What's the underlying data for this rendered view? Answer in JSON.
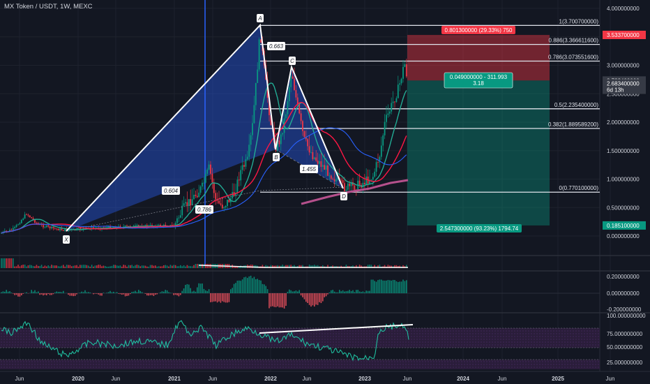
{
  "header": {
    "title": "MX Token / USDT, 1W, MEXC"
  },
  "price_axis": {
    "labels": [
      {
        "v": 4.0,
        "t": "4.000000000"
      },
      {
        "v": 3.5,
        "t": "3.500000000"
      },
      {
        "v": 3.0,
        "t": "3.000000000"
      },
      {
        "v": 2.5,
        "t": "2.500000000"
      },
      {
        "v": 2.0,
        "t": "2.000000000"
      },
      {
        "v": 1.5,
        "t": "1.500000000"
      },
      {
        "v": 1.0,
        "t": "1.000000000"
      },
      {
        "v": 0.5,
        "t": "0.500000000"
      },
      {
        "v": 0.0,
        "t": "0.000000000"
      }
    ],
    "tags": [
      {
        "v": 3.5337,
        "t": "3.533700000",
        "color": "#f23645"
      },
      {
        "v": 2.7324,
        "t": "2.732400000",
        "color": "#363a45"
      },
      {
        "v": 2.6834,
        "t": "2.683400000",
        "color": "#363a45"
      },
      {
        "v": 2.57,
        "t": "6d 13h",
        "color": "#363a45"
      },
      {
        "v": 0.1851,
        "t": "0.185100000",
        "color": "#089981"
      }
    ]
  },
  "macd_axis": [
    "0.200000000",
    "0.000000000",
    "-0.200000000"
  ],
  "rsi_axis": [
    "100.000000000",
    "75.000000000",
    "50.000000000",
    "25.000000000"
  ],
  "time_axis": [
    "Jun",
    "2020",
    "Jun",
    "2021",
    "Jun",
    "2022",
    "Jun",
    "2023",
    "Jun",
    "2024",
    "Jun",
    "2025",
    "Jun"
  ],
  "pattern": {
    "points": [
      "X",
      "A",
      "B",
      "C",
      "D"
    ],
    "ratios": [
      "0.604",
      "0.786",
      "0.663",
      "1.455"
    ]
  },
  "fib_levels": [
    {
      "v": 3.7007,
      "t": "1(3.700700000)"
    },
    {
      "v": 3.3666116,
      "t": "0.886(3.366611600)"
    },
    {
      "v": 3.0735516,
      "t": "0.786(3.073551600)"
    },
    {
      "v": 2.2354,
      "t": "0.5(2.235400000)"
    },
    {
      "v": 1.8895892,
      "t": "0.382(1.889589200)"
    },
    {
      "v": 0.7701,
      "t": "0(0.770100000)"
    }
  ],
  "position": {
    "loss_label": "0.801300000 (29.33%) 750",
    "ratio_label_1": "0.049000000 - 311.993",
    "ratio_label_2": "3.18",
    "profit_label": "2.547300000 (93.23%) 1794.74"
  },
  "colors": {
    "background": "#131722",
    "up": "#089981",
    "down": "#f23645",
    "pattern_fill": "#2962ff",
    "ma_green": "#22ab94",
    "ma_red": "#ff1744",
    "ma_blue": "#2962ff",
    "rsi": "#1fbd9e"
  }
}
